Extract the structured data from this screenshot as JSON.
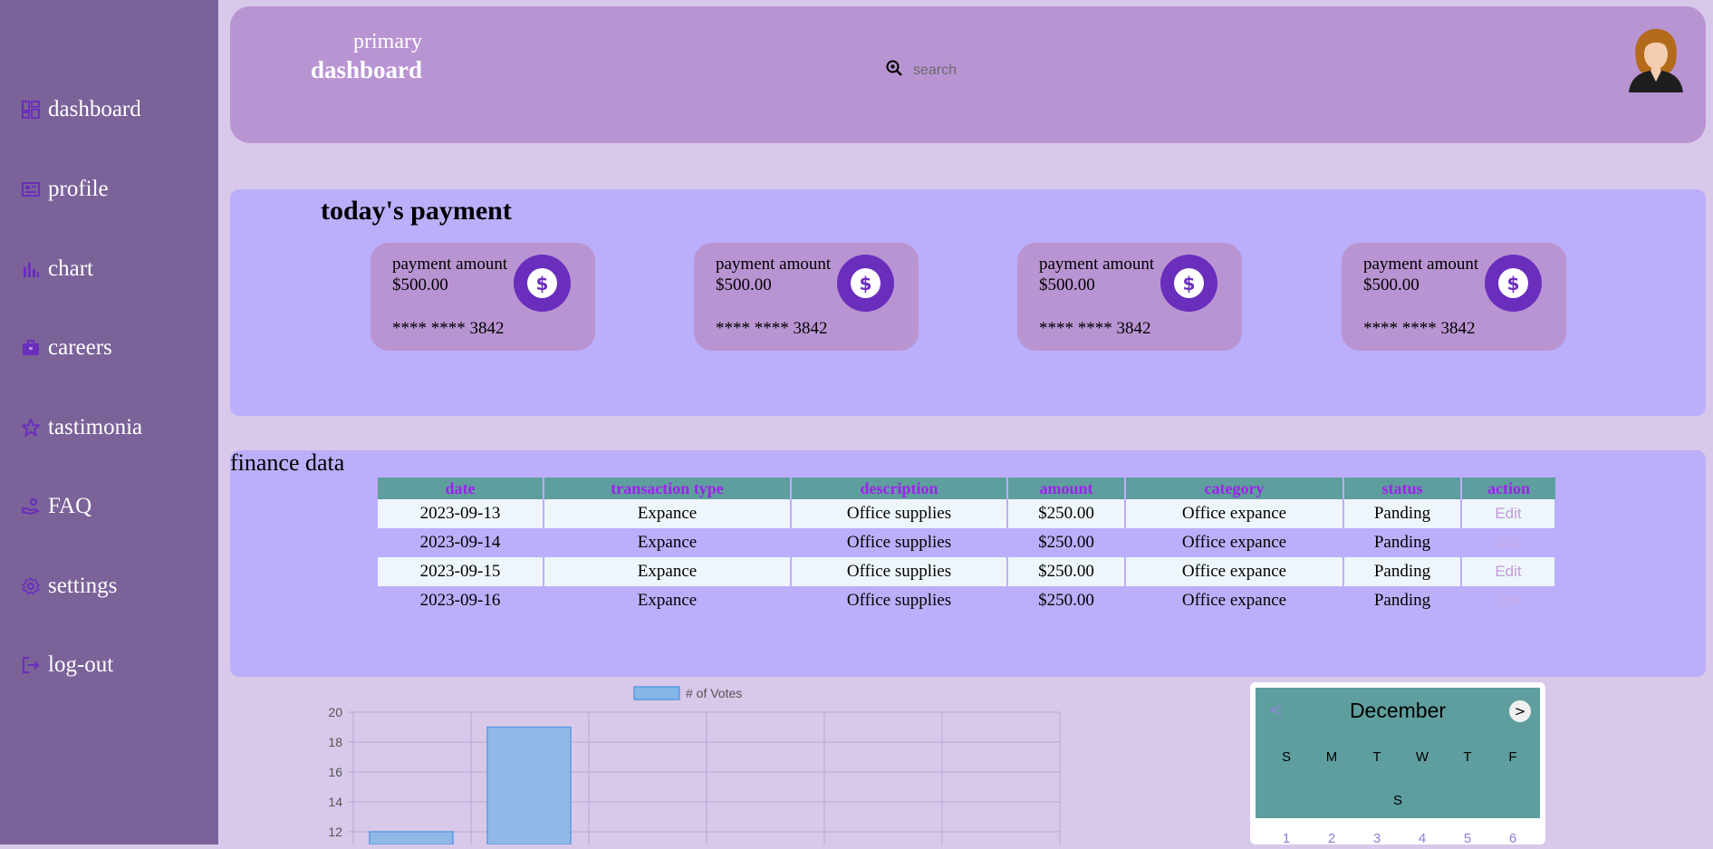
{
  "header": {
    "brand_small": "primary",
    "brand_big": "dashboard",
    "search_placeholder": "search"
  },
  "sidebar": {
    "items": [
      {
        "label": "dashboard",
        "icon": "dashboard-icon"
      },
      {
        "label": "profile",
        "icon": "profile-card-icon"
      },
      {
        "label": "chart",
        "icon": "bar-chart-icon"
      },
      {
        "label": "careers",
        "icon": "briefcase-icon"
      },
      {
        "label": "tastimonia",
        "icon": "star-icon"
      },
      {
        "label": "FAQ",
        "icon": "hand-coin-icon"
      },
      {
        "label": "settings",
        "icon": "gear-icon"
      },
      {
        "label": "log-out",
        "icon": "logout-icon"
      }
    ]
  },
  "payment": {
    "title": "today's payment",
    "cards": [
      {
        "label": "payment amount",
        "amount": "$500.00",
        "card_number": "**** **** 3842"
      },
      {
        "label": "payment amount",
        "amount": "$500.00",
        "card_number": "**** **** 3842"
      },
      {
        "label": "payment amount",
        "amount": "$500.00",
        "card_number": "**** **** 3842"
      },
      {
        "label": "payment amount",
        "amount": "$500.00",
        "card_number": "**** **** 3842"
      }
    ]
  },
  "finance": {
    "title": "finance data",
    "columns": [
      "date",
      "transaction type",
      "description",
      "amount",
      "category",
      "status",
      "action"
    ],
    "rows": [
      [
        "2023-09-13",
        "Expance",
        "Office supplies",
        "$250.00",
        "Office expance",
        "Panding",
        "Edit"
      ],
      [
        "2023-09-14",
        "Expance",
        "Office supplies",
        "$250.00",
        "Office expance",
        "Panding",
        "Edit"
      ],
      [
        "2023-09-15",
        "Expance",
        "Office supplies",
        "$250.00",
        "Office expance",
        "Panding",
        "Edit"
      ],
      [
        "2023-09-16",
        "Expance",
        "Office supplies",
        "$250.00",
        "Office expance",
        "Panding",
        "Edit"
      ]
    ]
  },
  "chart_data": {
    "type": "bar",
    "series": [
      {
        "name": "# of Votes",
        "values": [
          12,
          19
        ]
      }
    ],
    "yticks": [
      12,
      14,
      16,
      18,
      20
    ],
    "ylim_visible": [
      11,
      20
    ],
    "grid": true,
    "legend": "top",
    "bar_color": "#85b6e8"
  },
  "calendar": {
    "month": "December",
    "prev": "<",
    "next": ">",
    "weekdays": [
      "S",
      "M",
      "T",
      "W",
      "T",
      "F"
    ],
    "weekday_last": "S",
    "dates": [
      "1",
      "2",
      "3",
      "4",
      "5",
      "6"
    ]
  },
  "colors": {
    "sidebar": "#7b6299",
    "header": "#b994d2",
    "panel": "#bbaefa",
    "accent": "#6a2ebc",
    "table_header": "#5f9e9e"
  }
}
